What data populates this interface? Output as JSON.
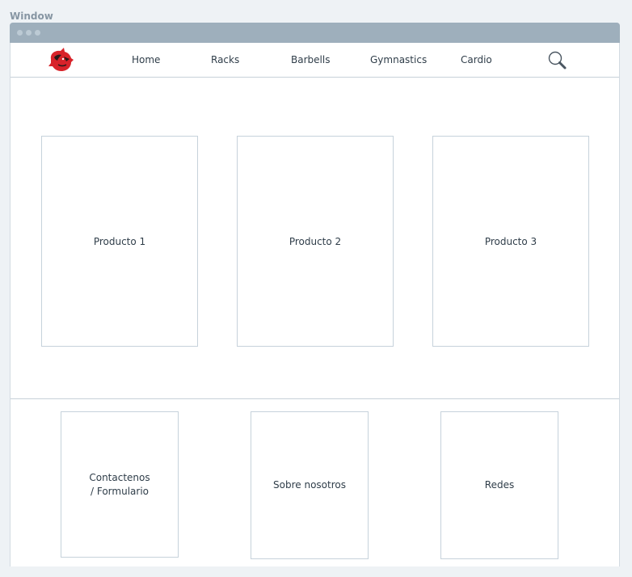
{
  "window": {
    "caption": "Window"
  },
  "nav": {
    "items": [
      {
        "label": "Home"
      },
      {
        "label": "Racks"
      },
      {
        "label": "Barbells"
      },
      {
        "label": "Gymnastics"
      },
      {
        "label": "Cardio"
      }
    ],
    "logo_icon": "rhino-logo-icon",
    "search_icon": "search-icon"
  },
  "products": [
    {
      "label": "Producto 1"
    },
    {
      "label": "Producto 2"
    },
    {
      "label": "Producto 3"
    }
  ],
  "footer": {
    "boxes": [
      {
        "line1": "Contactenos",
        "line2": "/ Formulario"
      },
      {
        "label": "Sobre nosotros"
      },
      {
        "label": "Redes"
      }
    ]
  },
  "colors": {
    "titlebar": "#9eafbc",
    "border": "#c6d2db",
    "logo_red": "#d8232a",
    "text": "#2f3d49"
  }
}
